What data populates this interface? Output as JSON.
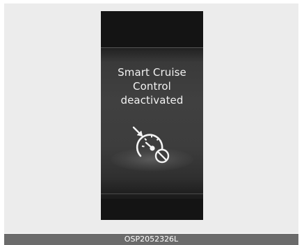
{
  "display": {
    "message_lines": [
      "Smart Cruise",
      "Control",
      "deactivated"
    ]
  },
  "icon": {
    "name": "smart-cruise-control-deactivated-icon"
  },
  "caption": {
    "code": "OSP2052326L"
  },
  "colors": {
    "display_bg": "#141414",
    "band": "#404040",
    "text": "#f2f2f2",
    "caption_bar": "#6b6b6b",
    "frame_bg": "#ececec"
  }
}
